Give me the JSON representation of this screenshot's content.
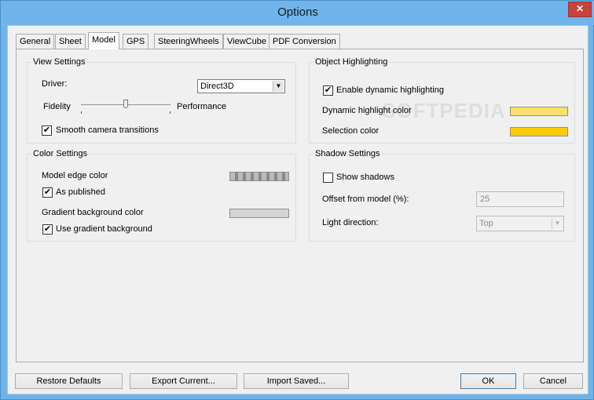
{
  "window": {
    "title": "Options",
    "close_glyph": "✕"
  },
  "tabs": [
    {
      "label": "General"
    },
    {
      "label": "Sheet"
    },
    {
      "label": "Model"
    },
    {
      "label": "GPS"
    },
    {
      "label": "SteeringWheels"
    },
    {
      "label": "ViewCube"
    },
    {
      "label": "PDF Conversion"
    }
  ],
  "active_tab": "Model",
  "view_settings": {
    "legend": "View Settings",
    "driver_label": "Driver:",
    "driver_value": "Direct3D",
    "fidelity_label": "Fidelity",
    "performance_label": "Performance",
    "slider_position": 0.5,
    "smooth_label": "Smooth camera transitions",
    "smooth_checked": "✔"
  },
  "color_settings": {
    "legend": "Color Settings",
    "edge_color_label": "Model edge color",
    "as_published_label": "As published",
    "as_published_checked": "✔",
    "gradient_label": "Gradient background color",
    "use_gradient_label": "Use gradient background",
    "use_gradient_checked": "✔"
  },
  "object_highlighting": {
    "legend": "Object Highlighting",
    "enable_label": "Enable dynamic highlighting",
    "enable_checked": "✔",
    "dynamic_color_label": "Dynamic highlight color",
    "dynamic_color": "#ffe066",
    "selection_color_label": "Selection color",
    "selection_color": "#ffcc00"
  },
  "shadow_settings": {
    "legend": "Shadow Settings",
    "show_label": "Show shadows",
    "show_checked": "",
    "offset_label": "Offset from model (%):",
    "offset_value": "25",
    "light_label": "Light direction:",
    "light_value": "Top"
  },
  "buttons": {
    "restore": "Restore Defaults",
    "export": "Export Current...",
    "import": "Import Saved...",
    "ok": "OK",
    "cancel": "Cancel"
  },
  "watermark": "SOFTPEDIA"
}
